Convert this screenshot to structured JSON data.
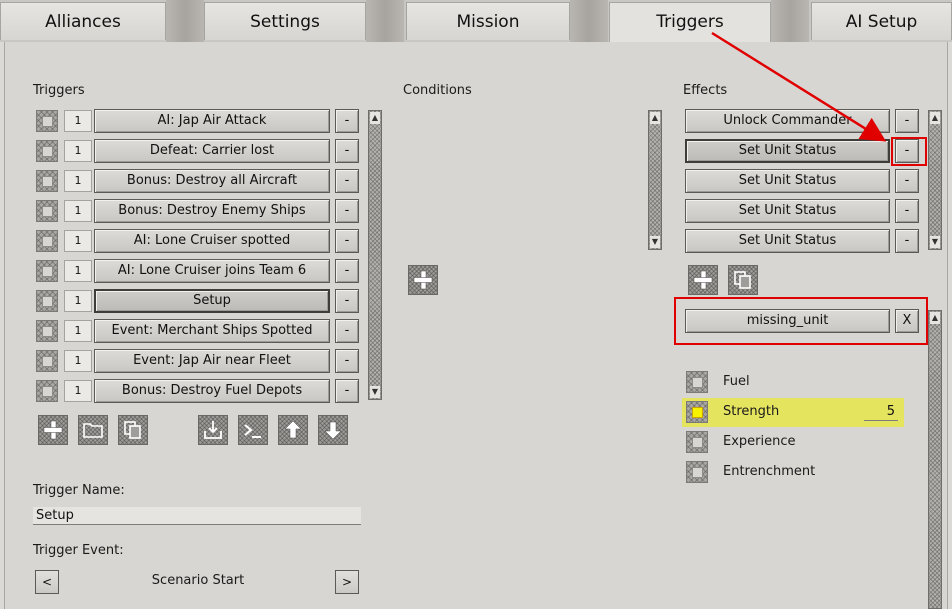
{
  "tabs": [
    {
      "label": "Alliances",
      "active": false
    },
    {
      "label": "Settings",
      "active": false
    },
    {
      "label": "Mission",
      "active": false
    },
    {
      "label": "Triggers",
      "active": true
    },
    {
      "label": "AI Setup",
      "active": false
    }
  ],
  "triggers": {
    "title": "Triggers",
    "items": [
      {
        "count": "1",
        "label": "AI: Jap Air Attack",
        "remove": "-"
      },
      {
        "count": "1",
        "label": "Defeat: Carrier lost",
        "remove": "-"
      },
      {
        "count": "1",
        "label": "Bonus: Destroy all Aircraft",
        "remove": "-"
      },
      {
        "count": "1",
        "label": "Bonus: Destroy Enemy Ships",
        "remove": "-"
      },
      {
        "count": "1",
        "label": "AI: Lone Cruiser spotted",
        "remove": "-"
      },
      {
        "count": "1",
        "label": "AI: Lone Cruiser joins Team 6",
        "remove": "-"
      },
      {
        "count": "1",
        "label": "Setup",
        "remove": "-",
        "selected": true
      },
      {
        "count": "1",
        "label": "Event: Merchant Ships Spotted",
        "remove": "-"
      },
      {
        "count": "1",
        "label": "Event: Jap Air near Fleet",
        "remove": "-"
      },
      {
        "count": "1",
        "label": "Bonus: Destroy Fuel Depots",
        "remove": "-"
      }
    ],
    "name_label": "Trigger Name:",
    "name_value": "Setup",
    "event_label": "Trigger Event:",
    "event_value": "Scenario Start",
    "prev": "<",
    "next": ">"
  },
  "conditions": {
    "title": "Conditions"
  },
  "effects": {
    "title": "Effects",
    "items": [
      {
        "label": "Unlock Commander",
        "remove": "-"
      },
      {
        "label": "Set Unit Status",
        "remove": "-",
        "selected": true
      },
      {
        "label": "Set Unit Status",
        "remove": "-"
      },
      {
        "label": "Set Unit Status",
        "remove": "-"
      },
      {
        "label": "Set Unit Status",
        "remove": "-"
      }
    ],
    "unit": {
      "label": "missing_unit",
      "clear": "X"
    },
    "status_options": [
      {
        "label": "Fuel",
        "checked": false
      },
      {
        "label": "Strength",
        "checked": true,
        "value": "5"
      },
      {
        "label": "Experience",
        "checked": false
      },
      {
        "label": "Entrenchment",
        "checked": false
      }
    ]
  },
  "colors": {
    "annotation": "#e00000",
    "highlight": "#f0f000"
  }
}
